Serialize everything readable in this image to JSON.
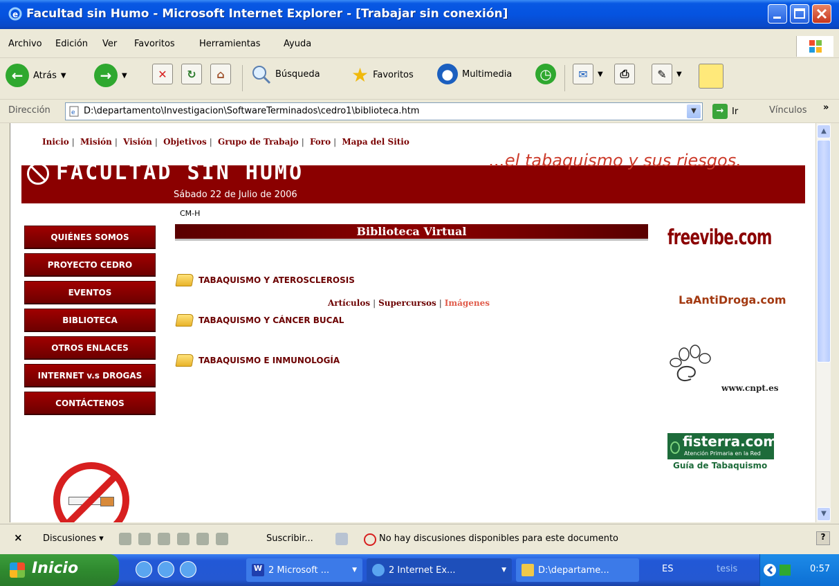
{
  "window": {
    "title": "Facultad sin Humo - Microsoft Internet Explorer - [Trabajar sin conexión]"
  },
  "menu": [
    "Archivo",
    "Edición",
    "Ver",
    "Favoritos",
    "Herramientas",
    "Ayuda"
  ],
  "toolbar": {
    "back_label": "Atrás",
    "search_label": "Búsqueda",
    "favorites_label": "Favoritos",
    "media_label": "Multimedia"
  },
  "address": {
    "label": "Dirección",
    "url": "D:\\departamento\\Investigacion\\SoftwareTerminados\\cedro1\\biblioteca.htm",
    "go_label": "Ir",
    "links_label": "Vínculos"
  },
  "page": {
    "topnav": [
      "Inicio",
      "Misión",
      "Visión",
      "Objetivos",
      "Grupo de Trabajo",
      "Foro",
      "Mapa del Sitio"
    ],
    "logo_text": "FACULTAD SIN HUMO",
    "date": "Sábado 22 de Julio de 2006",
    "slogan": "...el tabaquismo y sus riesgos.",
    "marker": "CM-H",
    "side_menu": [
      "QUIÉNES SOMOS",
      "PROYECTO CEDRO",
      "EVENTOS",
      "BIBLIOTECA",
      "OTROS ENLACES",
      "INTERNET v.s DROGAS",
      "CONTÁCTENOS"
    ],
    "section_title": "Biblioteca Virtual",
    "topics": [
      "TABAQUISMO Y ATEROSCLEROSIS",
      "TABAQUISMO Y CÁNCER BUCAL",
      "TABAQUISMO E INMUNOLOGÍA"
    ],
    "sublinks": {
      "articulos": "Artículos",
      "supercursos": "Supercursos",
      "imagenes": "Imágenes"
    },
    "sponsors": {
      "freevibe": "freevibe.com",
      "antidroga": "LaAntiDroga.com",
      "cnpt": "www.cnpt.es",
      "fisterra": "fisterra.com",
      "fisterra_sub": "Atención Primaria en la Red",
      "guia": "Guía de Tabaquismo"
    }
  },
  "discussions": {
    "label": "Discusiones",
    "subscribe": "Suscribir...",
    "message": "No hay discusiones disponibles para este documento"
  },
  "taskbar": {
    "start": "Inicio",
    "tasks": [
      "2 Microsoft ...",
      "2 Internet Ex...",
      "D:\\departame..."
    ],
    "lang": "ES",
    "tesis": "tesis",
    "clock": "0:57"
  }
}
